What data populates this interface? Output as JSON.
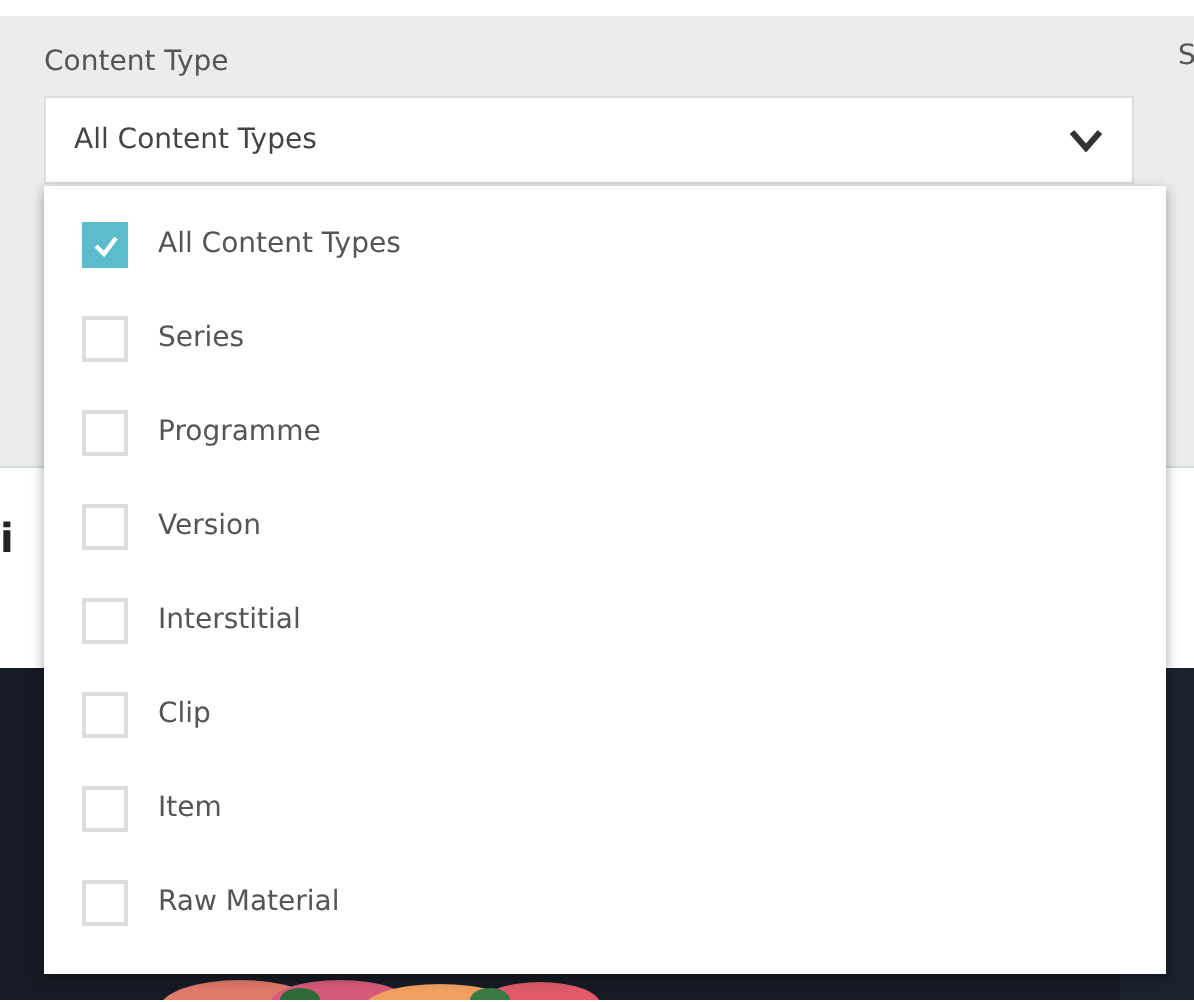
{
  "filter": {
    "label": "Content Type",
    "value": "All Content Types",
    "next_label": "S",
    "expanded": true,
    "options": [
      {
        "label": "All Content Types",
        "checked": true
      },
      {
        "label": "Series",
        "checked": false
      },
      {
        "label": "Programme",
        "checked": false
      },
      {
        "label": "Version",
        "checked": false
      },
      {
        "label": "Interstitial",
        "checked": false
      },
      {
        "label": "Clip",
        "checked": false
      },
      {
        "label": "Item",
        "checked": false
      },
      {
        "label": "Raw Material",
        "checked": false
      }
    ]
  },
  "section": {
    "heading": "i"
  }
}
